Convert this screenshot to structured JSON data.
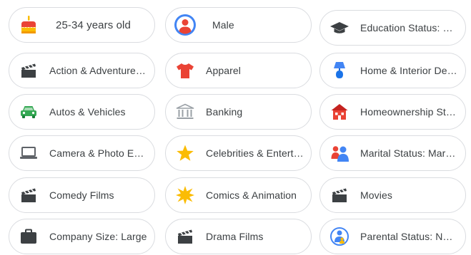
{
  "columns": [
    {
      "chips": [
        {
          "label": "25-34 years old",
          "icon": "birthday-cake-icon"
        },
        {
          "label": "Action & Adventure Films",
          "icon": "clapperboard-icon"
        },
        {
          "label": "Autos & Vehicles",
          "icon": "car-icon"
        },
        {
          "label": "Camera & Photo Equipment",
          "icon": "laptop-icon"
        },
        {
          "label": "Comedy Films",
          "icon": "clapperboard-icon"
        },
        {
          "label": "Company Size: Large",
          "icon": "briefcase-icon"
        }
      ]
    },
    {
      "chips": [
        {
          "label": "Male",
          "icon": "person-avatar-icon"
        },
        {
          "label": "Apparel",
          "icon": "shirt-icon"
        },
        {
          "label": "Banking",
          "icon": "bank-icon"
        },
        {
          "label": "Celebrities & Entertainment News",
          "icon": "star-icon"
        },
        {
          "label": "Comics & Animation",
          "icon": "burst-icon"
        },
        {
          "label": "Drama Films",
          "icon": "clapperboard-icon"
        }
      ]
    },
    {
      "chips": [
        {
          "label": "Education Status: Bachelor's Degree",
          "icon": "graduation-cap-icon"
        },
        {
          "label": "Home & Interior Decor",
          "icon": "lamp-icon"
        },
        {
          "label": "Homeownership Status",
          "icon": "house-icon"
        },
        {
          "label": "Marital Status: Married",
          "icon": "couple-icon"
        },
        {
          "label": "Movies",
          "icon": "clapperboard-icon"
        },
        {
          "label": "Parental Status: Not a Parent",
          "icon": "parent-child-icon"
        }
      ]
    }
  ],
  "colors": {
    "border": "#dadce0",
    "text": "#3c4043",
    "google_blue": "#4285f4",
    "google_red": "#ea4335",
    "google_yellow": "#fbbc04",
    "google_green": "#34a853",
    "icon_dark": "#3c4043",
    "icon_gray": "#9aa0a6"
  }
}
